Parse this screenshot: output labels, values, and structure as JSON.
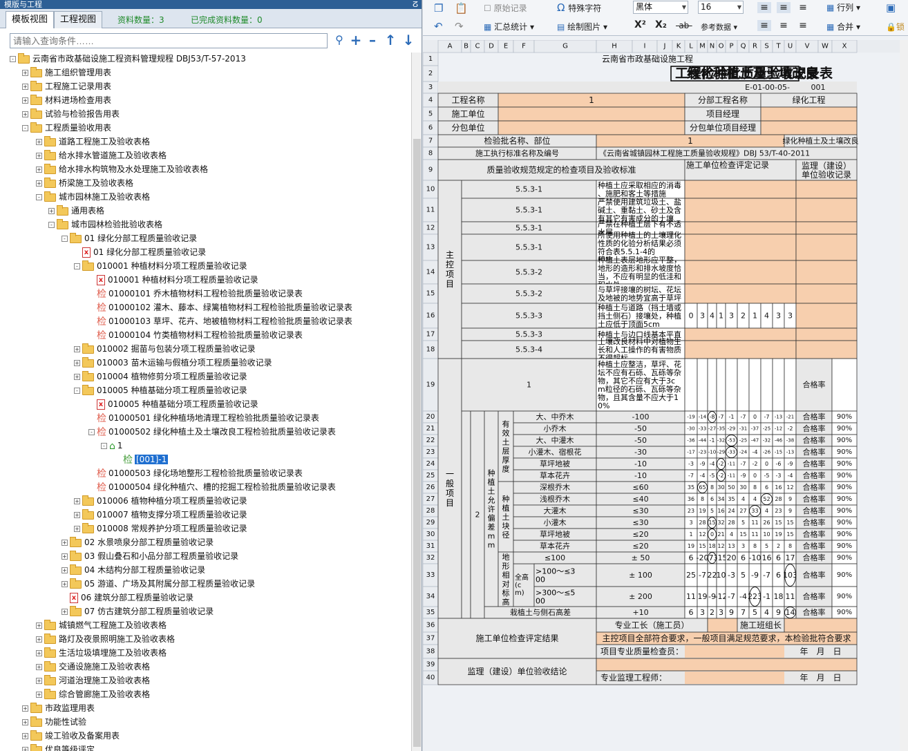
{
  "window": {
    "title": "模版与工程",
    "pin": "ⵒ"
  },
  "tabs": [
    {
      "label": "模板视图",
      "active": true
    },
    {
      "label": "工程视图",
      "active": false
    }
  ],
  "stats": {
    "count_label": "资料数量：3",
    "done_label": "已完成资料数量：0"
  },
  "search": {
    "placeholder": "请输入查询条件……"
  },
  "tree_buttons": [
    "search-icon",
    "plus-icon",
    "minus-icon",
    "arrow-up-icon",
    "arrow-down-icon"
  ],
  "tree": [
    {
      "depth": 0,
      "exp": "-",
      "icon": "folder",
      "label": "云南省市政基础设施工程资料管理规程 DBJ53/T-57-2013"
    },
    {
      "depth": 1,
      "exp": "+",
      "icon": "folder",
      "label": "施工组织管理用表"
    },
    {
      "depth": 1,
      "exp": "+",
      "icon": "folder",
      "label": "工程施工记录用表"
    },
    {
      "depth": 1,
      "exp": "+",
      "icon": "folder",
      "label": "材料进场检查用表"
    },
    {
      "depth": 1,
      "exp": "+",
      "icon": "folder",
      "label": "试验与检验报告用表"
    },
    {
      "depth": 1,
      "exp": "-",
      "icon": "folder",
      "label": "工程质量验收用表"
    },
    {
      "depth": 2,
      "exp": "+",
      "icon": "folder",
      "label": "道路工程施工及验收表格"
    },
    {
      "depth": 2,
      "exp": "+",
      "icon": "folder",
      "label": "给水排水管道施工及验收表格"
    },
    {
      "depth": 2,
      "exp": "+",
      "icon": "folder",
      "label": "给水排水构筑物及水处理施工及验收表格"
    },
    {
      "depth": 2,
      "exp": "+",
      "icon": "folder",
      "label": "桥梁施工及验收表格"
    },
    {
      "depth": 2,
      "exp": "-",
      "icon": "folder",
      "label": "城市园林施工及验收表格"
    },
    {
      "depth": 3,
      "exp": "+",
      "icon": "folder",
      "label": "通用表格"
    },
    {
      "depth": 3,
      "exp": "-",
      "icon": "folder",
      "label": "城市园林检验批验收表格"
    },
    {
      "depth": 4,
      "exp": "-",
      "icon": "folder",
      "label": "01 绿化分部工程质量验收记录"
    },
    {
      "depth": 5,
      "exp": "",
      "icon": "xdoc",
      "label": "01 绿化分部工程质量验收记录"
    },
    {
      "depth": 5,
      "exp": "-",
      "icon": "folder",
      "label": "010001 种植材料分项工程质量验收记录"
    },
    {
      "depth": 6,
      "exp": "",
      "icon": "xdoc",
      "label": "010001 种植材料分项工程质量验收记录"
    },
    {
      "depth": 6,
      "exp": "",
      "icon": "jian",
      "label": "01000101 乔木植物材料工程检验批质量验收记录表"
    },
    {
      "depth": 6,
      "exp": "",
      "icon": "jian",
      "label": "01000102 灌木、藤本、绿篱植物材料工程检验批质量验收记录表"
    },
    {
      "depth": 6,
      "exp": "",
      "icon": "jian",
      "label": "01000103 草坪、花卉、地被植物材料工程检验批质量验收记录表"
    },
    {
      "depth": 6,
      "exp": "",
      "icon": "jian",
      "label": "01000104 竹类植物材料工程检验批质量验收记录表"
    },
    {
      "depth": 5,
      "exp": "+",
      "icon": "folder",
      "label": "010002 掘苗与包装分项工程质量验收记录"
    },
    {
      "depth": 5,
      "exp": "+",
      "icon": "folder",
      "label": "010003 苗木运输与假植分项工程质量验收记录"
    },
    {
      "depth": 5,
      "exp": "+",
      "icon": "folder",
      "label": "010004 植物修剪分项工程质量验收记录"
    },
    {
      "depth": 5,
      "exp": "-",
      "icon": "folder",
      "label": "010005 种植基础分项工程质量验收记录"
    },
    {
      "depth": 6,
      "exp": "",
      "icon": "xdoc",
      "label": "010005 种植基础分项工程质量验收记录"
    },
    {
      "depth": 6,
      "exp": "",
      "icon": "jian",
      "label": "01000501 绿化种植场地清理工程检验批质量验收记录表"
    },
    {
      "depth": 6,
      "exp": "-",
      "icon": "jian",
      "label": "01000502 绿化种植土及土壤改良工程检验批质量验收记录表"
    },
    {
      "depth": 7,
      "exp": "-",
      "icon": "home",
      "label": "1"
    },
    {
      "depth": 8,
      "exp": "",
      "icon": "jiang",
      "label": "[001]-1",
      "selected": true
    },
    {
      "depth": 6,
      "exp": "",
      "icon": "jian",
      "label": "01000503 绿化场地整形工程检验批质量验收记录表"
    },
    {
      "depth": 6,
      "exp": "",
      "icon": "jian",
      "label": "01000504 绿化种植穴、槽的挖掘工程检验批质量验收记录表"
    },
    {
      "depth": 5,
      "exp": "+",
      "icon": "folder",
      "label": "010006 植物种植分项工程质量验收记录"
    },
    {
      "depth": 5,
      "exp": "+",
      "icon": "folder",
      "label": "010007 植物支撑分项工程质量验收记录"
    },
    {
      "depth": 5,
      "exp": "+",
      "icon": "folder",
      "label": "010008 常规养护分项工程质量验收记录"
    },
    {
      "depth": 4,
      "exp": "+",
      "icon": "folder",
      "label": "02 水景喷泉分部工程质量验收记录"
    },
    {
      "depth": 4,
      "exp": "+",
      "icon": "folder",
      "label": "03 假山叠石和小品分部工程质量验收记录"
    },
    {
      "depth": 4,
      "exp": "+",
      "icon": "folder",
      "label": "04 木结构分部工程质量验收记录"
    },
    {
      "depth": 4,
      "exp": "+",
      "icon": "folder",
      "label": "05 游道、广场及其附属分部工程质量验收记录"
    },
    {
      "depth": 4,
      "exp": "",
      "icon": "xdoc",
      "label": "06 建筑分部工程质量验收记录"
    },
    {
      "depth": 4,
      "exp": "+",
      "icon": "folder",
      "label": "07 仿古建筑分部工程质量验收记录"
    },
    {
      "depth": 2,
      "exp": "+",
      "icon": "folder",
      "label": "城镇燃气工程施工及验收表格"
    },
    {
      "depth": 2,
      "exp": "+",
      "icon": "folder",
      "label": "路灯及夜景照明施工及验收表格"
    },
    {
      "depth": 2,
      "exp": "+",
      "icon": "folder",
      "label": "生活垃圾填埋施工及验收表格"
    },
    {
      "depth": 2,
      "exp": "+",
      "icon": "folder",
      "label": "交通设施施工及验收表格"
    },
    {
      "depth": 2,
      "exp": "+",
      "icon": "folder",
      "label": "河道治理施工及验收表格"
    },
    {
      "depth": 2,
      "exp": "+",
      "icon": "folder",
      "label": "综合管廊施工及验收表格"
    },
    {
      "depth": 1,
      "exp": "+",
      "icon": "folder",
      "label": "市政监理用表"
    },
    {
      "depth": 1,
      "exp": "+",
      "icon": "folder",
      "label": "功能性试验"
    },
    {
      "depth": 1,
      "exp": "+",
      "icon": "folder",
      "label": "竣工验收及备案用表"
    },
    {
      "depth": 1,
      "exp": "+",
      "icon": "folder",
      "label": "优良等级评定"
    }
  ],
  "toolbar": {
    "restore_label": "原始记录",
    "special_char_label": "特殊字符",
    "font_name": "黑体",
    "font_size": "16",
    "rowcol_label": "行列",
    "summary_label": "汇总统计",
    "draw_image_label": "绘制图片",
    "ref_data_label": "参考数据",
    "merge_label": "合并",
    "lock_label": "锁"
  },
  "columns": [
    "A",
    "B",
    "C",
    "D",
    "E",
    "F",
    "G",
    "H",
    "I",
    "J",
    "K",
    "L",
    "M",
    "N",
    "O",
    "P",
    "Q",
    "R",
    "S",
    "T",
    "U",
    "V",
    "W",
    "X"
  ],
  "sheet": {
    "header_org": "云南省市政基础设施工程",
    "title_left": "绿化种植土及土壤改良",
    "title_right": "工程检验批质量验收记录表",
    "code": "E-01-00-05-",
    "code_no": "001",
    "project_name_label": "工程名称",
    "project_name": "1",
    "sub_project_label": "分部工程名称",
    "sub_project": "绿化工程",
    "contractor_label": "施工单位",
    "pm_label": "项目经理",
    "subcontractor_label": "分包单位",
    "sub_pm_label": "分包单位项目经理",
    "batch_label": "检验批名称、部位",
    "batch_value": "1",
    "batch_name": "绿化种植土及土壤改良",
    "standard_label": "施工执行标准名称及编号",
    "standard": "《云南省城镇园林工程施工质量验收规程》DBJ 53/T-40-2011",
    "items_header": "质量验收规范规定的检查项目及验收标准",
    "contractor_check_header": "施工单位检查评定记录",
    "supervisor_header_1": "监理（建设）",
    "supervisor_header_2": "单位验收记录",
    "main_items_label": "主控项目",
    "general_items_label": "一般项目",
    "general_no": "2",
    "tolerance_label": "种植土允许偏差mm",
    "main_items": [
      {
        "row": 10,
        "clause": "5.5.3-1",
        "text": "种植土应采取相应的消毒、施肥和客土等措施"
      },
      {
        "row": 11,
        "clause": "5.5.3-1",
        "text": "严禁使用建筑垃圾土、盐碱土、重黏土、砂土及含有其它有害成分的土壤"
      },
      {
        "row": 12,
        "clause": "5.5.3-1",
        "text": "严禁在种植土层下有不透水层"
      },
      {
        "row": 13,
        "clause": "5.5.3-1",
        "text": "所使用种植土的土壤理化性质的化验分析结果必须符合表5.5.1-4的规定"
      },
      {
        "row": 14,
        "clause": "5.5.3-2",
        "text": "种植土表层地形应平整，地形的造形和排水坡度恰当，不应有明显的低洼和积水处"
      },
      {
        "row": 15,
        "clause": "5.5.3-2",
        "text": "与草坪接壤的树坛、花坛及地被的地势宜高于草坪"
      },
      {
        "row": 16,
        "clause": "5.5.3-3",
        "text": "种植土与道路（挡土墙或挡土侧石）接壤处，种植土应低于顶面5cm",
        "values": [
          "0",
          "3",
          "4",
          "1",
          "3",
          "2",
          "1",
          "4",
          "3",
          "3"
        ]
      },
      {
        "row": 17,
        "clause": "5.5.3-3",
        "text": "种植土与边口线基本平直"
      },
      {
        "row": 18,
        "clause": "5.5.3-4",
        "text": "土壤改良材料中对植物生长和人工操作的有害物质不得超标"
      }
    ],
    "row19": {
      "no": "1",
      "text": "种植土应整洁，草坪、花坛不应有石砾、瓦砾等杂物，其它不应有大于3cm粒径的石砾、瓦砾等杂物，且其含量不应大于10%",
      "rate_label": "合格率"
    },
    "groups": [
      {
        "label": "有效土层厚度",
        "rows": [
          20,
          25
        ]
      },
      {
        "label": "种植土块径",
        "rows": [
          26,
          31
        ]
      },
      {
        "label": "地形相对标高",
        "rows": [
          32,
          34
        ]
      }
    ],
    "height_label": "全高(cm)",
    "tol_rows": [
      {
        "row": 20,
        "item": "大、中乔木",
        "std": "-100",
        "vals": [
          "-19",
          "-14",
          "-8",
          "-7",
          "-1",
          "-7",
          "0",
          "-7",
          "-13",
          "-21"
        ],
        "rate": "90%"
      },
      {
        "row": 21,
        "item": "小乔木",
        "std": "-50",
        "vals": [
          "-30",
          "-33",
          "-27",
          "-35",
          "-29",
          "-31",
          "-37",
          "-25",
          "-12",
          "-2"
        ],
        "rate": "90%"
      },
      {
        "row": 22,
        "item": "大、中灌木",
        "std": "-50",
        "vals": [
          "-36",
          "-44",
          "-1",
          "-32",
          "-53",
          "-25",
          "-47",
          "-32",
          "-46",
          "-38"
        ],
        "rate": "90%"
      },
      {
        "row": 23,
        "item": "小灌木、宿根花",
        "std": "-30",
        "vals": [
          "-17",
          "-23",
          "-10",
          "-29",
          "-33",
          "-24",
          "-4",
          "-26",
          "-15",
          "-13"
        ],
        "rate": "90%"
      },
      {
        "row": 24,
        "item": "草坪地被",
        "std": "-10",
        "vals": [
          "-3",
          "-9",
          "-4",
          "-2",
          "-11",
          "-7",
          "-2",
          "0",
          "-6",
          "-9"
        ],
        "rate": "90%"
      },
      {
        "row": 25,
        "item": "草本花卉",
        "std": "-10",
        "vals": [
          "-7",
          "-4",
          "-5",
          "-2",
          "-11",
          "-9",
          "0",
          "-5",
          "-3",
          "-4"
        ],
        "rate": "90%"
      },
      {
        "row": 26,
        "item": "深根乔木",
        "std": "≤60",
        "vals": [
          "35",
          "65",
          "8",
          "30",
          "50",
          "30",
          "8",
          "6",
          "16",
          "12"
        ],
        "rate": "90%"
      },
      {
        "row": 27,
        "item": "浅根乔木",
        "std": "≤40",
        "vals": [
          "36",
          "8",
          "6",
          "34",
          "35",
          "4",
          "4",
          "52",
          "28",
          "9"
        ],
        "rate": "90%"
      },
      {
        "row": 28,
        "item": "大灌木",
        "std": "≤30",
        "vals": [
          "23",
          "19",
          "5",
          "16",
          "24",
          "27",
          "33",
          "4",
          "23",
          "9"
        ],
        "rate": "90%"
      },
      {
        "row": 29,
        "item": "小灌木",
        "std": "≤30",
        "vals": [
          "3",
          "28",
          "15",
          "32",
          "28",
          "5",
          "11",
          "26",
          "15",
          "15"
        ],
        "rate": "90%"
      },
      {
        "row": 30,
        "item": "草坪地被",
        "std": "≤20",
        "vals": [
          "1",
          "12",
          "0",
          "21",
          "4",
          "15",
          "11",
          "10",
          "19",
          "15"
        ],
        "rate": "90%"
      },
      {
        "row": 31,
        "item": "草本花卉",
        "std": "≤20",
        "vals": [
          "19",
          "15",
          "18",
          "12",
          "13",
          "3",
          "8",
          "5",
          "2",
          "8"
        ],
        "rate": "90%"
      },
      {
        "row": 32,
        "item": "≤100",
        "std": "± 50",
        "vals": [
          "6",
          "-20",
          "-73",
          "-15",
          "20",
          "6",
          "-10",
          "16",
          "6",
          "17"
        ],
        "rate": "90%"
      },
      {
        "row": 33,
        "item": ">100～≤300",
        "std": "± 100",
        "vals": [
          "25",
          "-7",
          "22",
          "10",
          "-3",
          "5",
          "-9",
          "-7",
          "6",
          "103"
        ],
        "rate": "90%"
      },
      {
        "row": 34,
        "item": ">300～≤500",
        "std": "± 200",
        "vals": [
          "11",
          "19",
          "-9",
          "-12",
          "-7",
          "-4",
          "223",
          "-1",
          "18",
          "11"
        ],
        "rate": "90%"
      },
      {
        "row": 35,
        "item": "栽植土与侧石高差",
        "std": "+10",
        "vals": [
          "6",
          "3",
          "2",
          "3",
          "9",
          "7",
          "5",
          "4",
          "9",
          "14"
        ],
        "rate": "90%"
      }
    ],
    "rate_label": "合格率",
    "contractor_result_label": "施工单位检查评定结果",
    "foreman_label": "专业工长（施工员）",
    "team_leader_label": "施工班组长",
    "contractor_result": "主控项目全部符合要求，一般项目满足规范要求，本检验批符合要求",
    "quality_inspector_label": "项目专业质量检查员：",
    "date_label": "年　月　日",
    "supervisor_result_label": "监理（建设）单位验收结论",
    "supervisor_engineer_label": "专业监理工程师："
  },
  "colors": {
    "peach": "#f7cfae",
    "header_gray": "#e8e8e8",
    "selection": "#1f6fd0"
  }
}
